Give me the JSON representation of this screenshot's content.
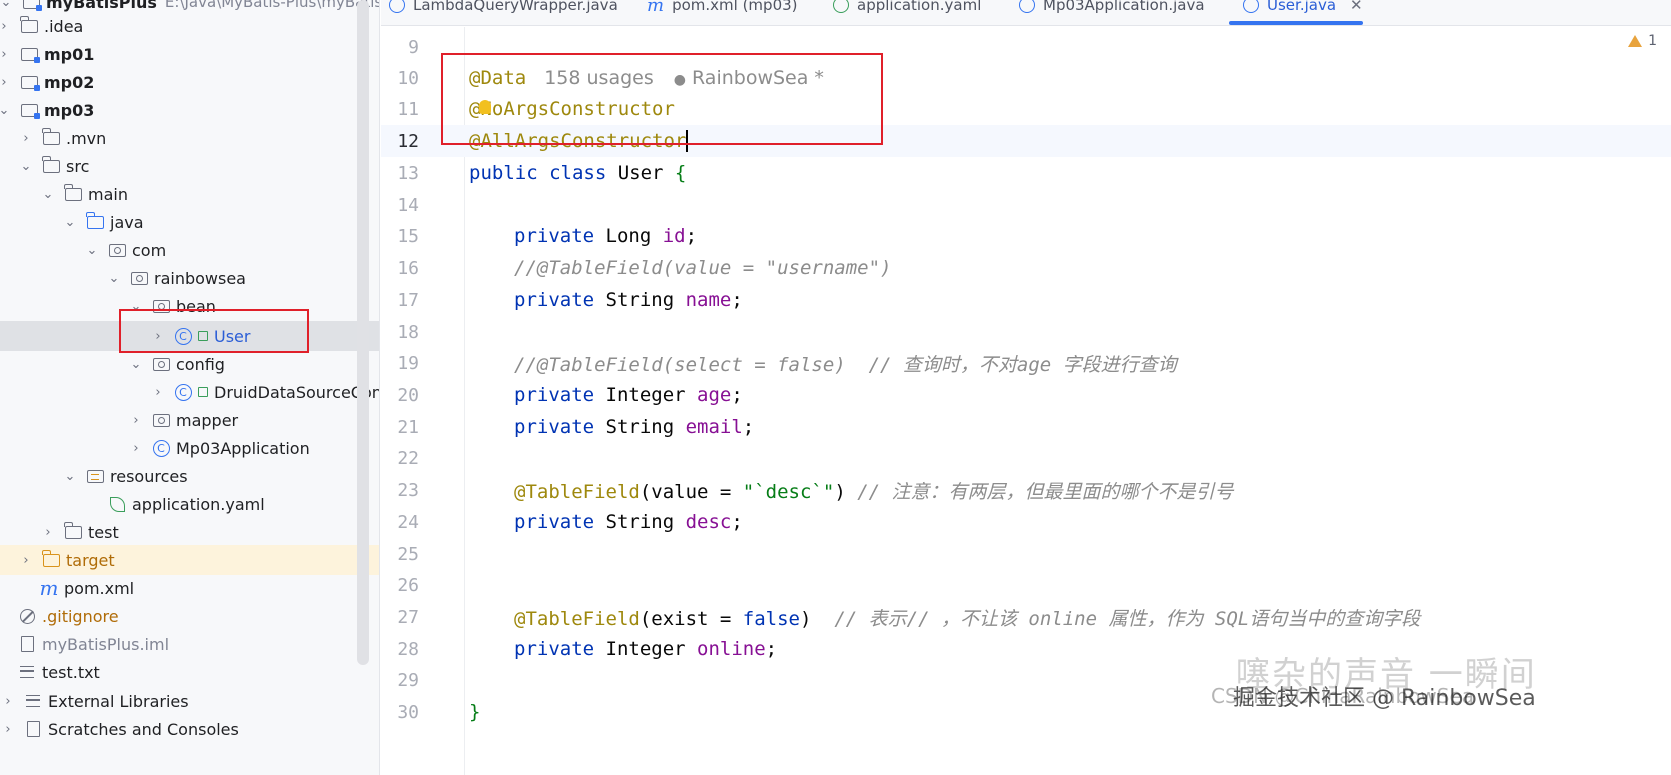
{
  "project": {
    "root_label": "myBatisPlus",
    "root_path": "E:\\Java\\MyBatis-Plus\\myBatisPlus",
    "items": [
      {
        "label": "idea",
        "dot_label": ".idea"
      },
      {
        "label": "mp01"
      },
      {
        "label": "mp02"
      },
      {
        "label": "mp03"
      },
      {
        "label": ".mvn"
      },
      {
        "label": "src"
      },
      {
        "label": "main"
      },
      {
        "label": "java"
      },
      {
        "label": "com"
      },
      {
        "label": "rainbowsea"
      },
      {
        "label": "bean"
      },
      {
        "label": "User"
      },
      {
        "label": "config"
      },
      {
        "label": "DruidDataSourceConfig"
      },
      {
        "label": "mapper"
      },
      {
        "label": "Mp03Application"
      },
      {
        "label": "resources"
      },
      {
        "label": "application.yaml"
      },
      {
        "label": "test"
      },
      {
        "label": "target"
      },
      {
        "label": "pom.xml"
      },
      {
        "label": ".gitignore"
      },
      {
        "label": "myBatisPlus.iml"
      },
      {
        "label": "test.txt"
      },
      {
        "label": "External Libraries"
      },
      {
        "label": "Scratches and Consoles"
      }
    ]
  },
  "tabs": [
    {
      "label": "LambdaQueryWrapper.java"
    },
    {
      "label": "pom.xml (mp03)"
    },
    {
      "label": "application.yaml"
    },
    {
      "label": "Mp03Application.java"
    },
    {
      "label": "User.java",
      "active": true
    }
  ],
  "editor": {
    "warning_count": "1",
    "usages": "158 usages",
    "author": "RainbowSea *",
    "lines": [
      {
        "n": "9"
      },
      {
        "n": "10"
      },
      {
        "n": "11"
      },
      {
        "n": "12"
      },
      {
        "n": "13"
      },
      {
        "n": "14"
      },
      {
        "n": "15"
      },
      {
        "n": "16"
      },
      {
        "n": "17"
      },
      {
        "n": "18"
      },
      {
        "n": "19"
      },
      {
        "n": "20"
      },
      {
        "n": "21"
      },
      {
        "n": "22"
      },
      {
        "n": "23"
      },
      {
        "n": "24"
      },
      {
        "n": "25"
      },
      {
        "n": "26"
      },
      {
        "n": "27"
      },
      {
        "n": "28"
      },
      {
        "n": "29"
      },
      {
        "n": "30"
      }
    ],
    "code": {
      "l10_ann": "@Data",
      "l11_ann": "@NoArgsConstructor",
      "l12_ann": "@AllArgsConstructor",
      "l13_kw": "public class",
      "l13_name": " User ",
      "l13_brace": "{",
      "private": "private",
      "l15_type": " Long ",
      "l15_field": "id",
      "semicolon": ";",
      "l16_comment": "//@TableField(value = \"username\")",
      "l17_type": " String ",
      "l17_field": "name",
      "l19_comment": "//@TableField(select = false)  // 查询时，不对age 字段进行查询",
      "l20_type": " Integer ",
      "l20_field": "age",
      "l21_type": " String ",
      "l21_field": "email",
      "l23_ann": "@TableField",
      "l23_open": "(value = ",
      "l23_str": "\"`desc`\"",
      "l23_close": ")",
      "l23_comment": " // 注意：有两层，但最里面的哪个不是引号",
      "l24_type": " String ",
      "l24_field": "desc",
      "l27_ann": "@TableField",
      "l27_open": "(exist = ",
      "l27_false": "false",
      "l27_close": ")",
      "l27_comment": "  // 表示// ，不让该 online 属性，作为 SQL语句当中的查询字段",
      "l28_type": " Integer ",
      "l28_field": "online",
      "l30_brace": "}"
    }
  },
  "watermarks": {
    "site": "掘金技术社区 @ RainbowSea",
    "overlay": "噻杂的声音 一瞬间",
    "csdn": "CSDN @ChinaRainbowSea"
  },
  "colors": {
    "keyword": "#0033b3",
    "annotation": "#9e880d",
    "field": "#871094",
    "string": "#067d17",
    "comment": "#8c8c8c",
    "accent": "#3574f0",
    "highlight_box": "#e0202a"
  }
}
